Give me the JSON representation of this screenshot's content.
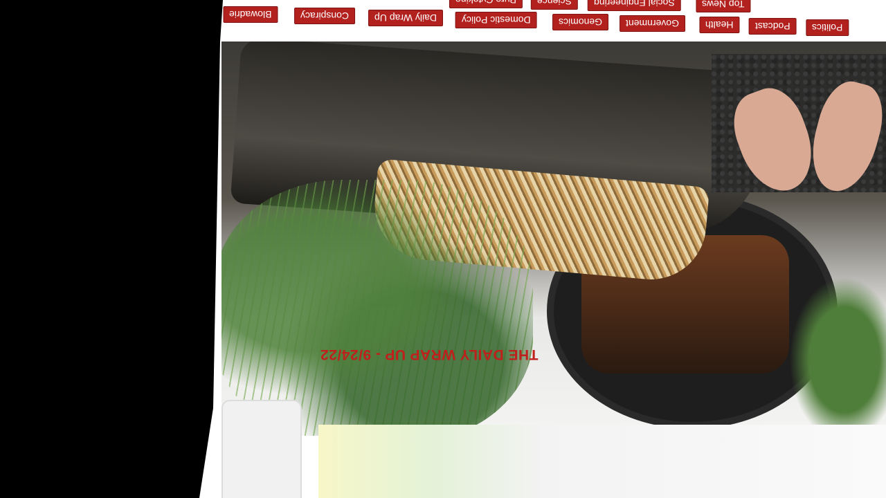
{
  "tags": [
    {
      "label": "Politics"
    },
    {
      "label": "Podcast"
    },
    {
      "label": "Health"
    },
    {
      "label": "Government"
    },
    {
      "label": "Genomics"
    },
    {
      "label": "Domestic Policy"
    },
    {
      "label": "Daily Wrap Up"
    },
    {
      "label": "Conspiracy"
    },
    {
      "label": "Blowadrie"
    },
    {
      "label": "Top News"
    },
    {
      "label": "Social Engineering"
    },
    {
      "label": "Science"
    },
    {
      "label": "Pure Cytokine"
    }
  ],
  "article": {
    "headline": "THE DAILY WRAP UP - 9/24/22"
  },
  "colors": {
    "tag_bg": "#b3211f",
    "headline": "#c0201c"
  }
}
